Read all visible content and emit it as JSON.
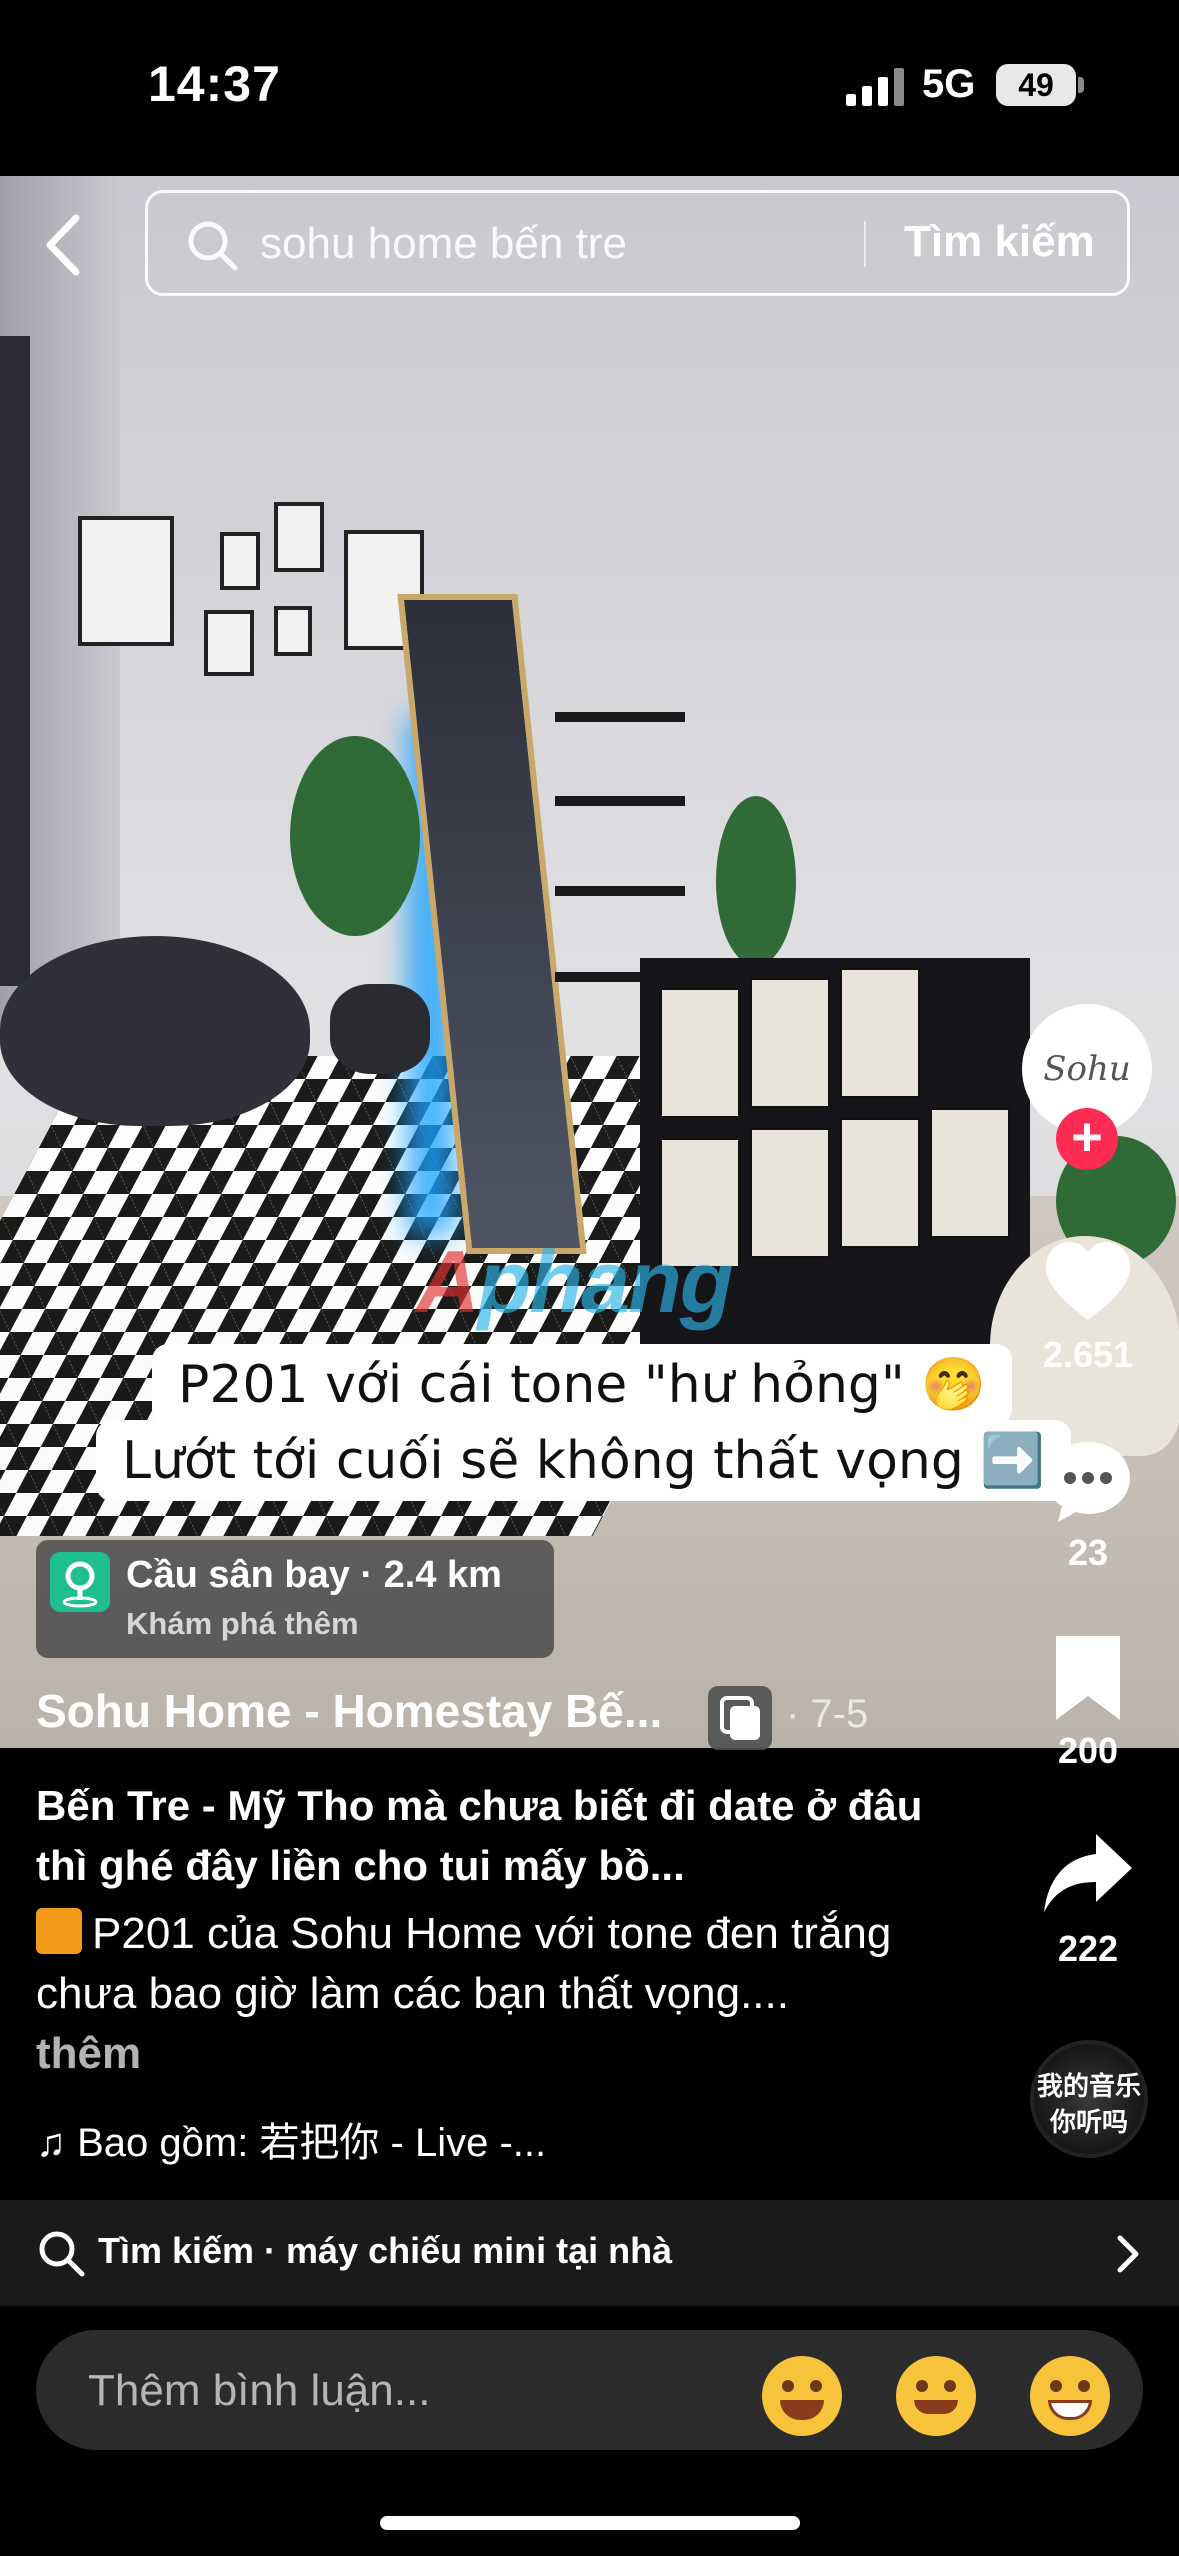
{
  "status_bar": {
    "time": "14:37",
    "network": "5G",
    "battery": "49"
  },
  "search": {
    "query": "sohu home bến tre",
    "button_label": "Tìm kiếm"
  },
  "video": {
    "watermark_a": "A",
    "watermark_b": "phang",
    "caption_line1": "P201 với cái tone \"hư hỏng\" 🤭",
    "caption_line2": "Lướt tới cuối sẽ không thất vọng ➡️",
    "page_dots": 5,
    "active_dot": 0
  },
  "rail": {
    "avatar_text": "Sohu",
    "likes": "2.651",
    "comments": "23",
    "saves": "200",
    "shares": "222",
    "music_disc_line1": "我的音乐",
    "music_disc_line2": "你听吗"
  },
  "location": {
    "title": "Cầu sân bay · 2.4 km",
    "subtitle": "Khám phá thêm"
  },
  "author": {
    "name": "Sohu Home - Homestay Bế...",
    "date": "· 7-5"
  },
  "description": {
    "title": "Bến Tre - Mỹ Tho mà chưa biết đi date ở đâu thì ghé đây liền cho tui mấy bồ...",
    "body": "P201 của Sohu Home với tone đen trắng chưa bao giờ làm các bạn thất vọng....",
    "more": "thêm",
    "music": "♫ Bao gồm: 若把你 - Live -..."
  },
  "suggestion": {
    "text": "Tìm kiếm · máy chiếu mini tại nhà"
  },
  "comment": {
    "placeholder": "Thêm bình luận...",
    "emojis": [
      "joy-emoji",
      "smiling-hearts-emoji",
      "grin-emoji"
    ]
  },
  "colors": {
    "accent": "#fe2c55",
    "location_icon": "#1fbf8f"
  }
}
